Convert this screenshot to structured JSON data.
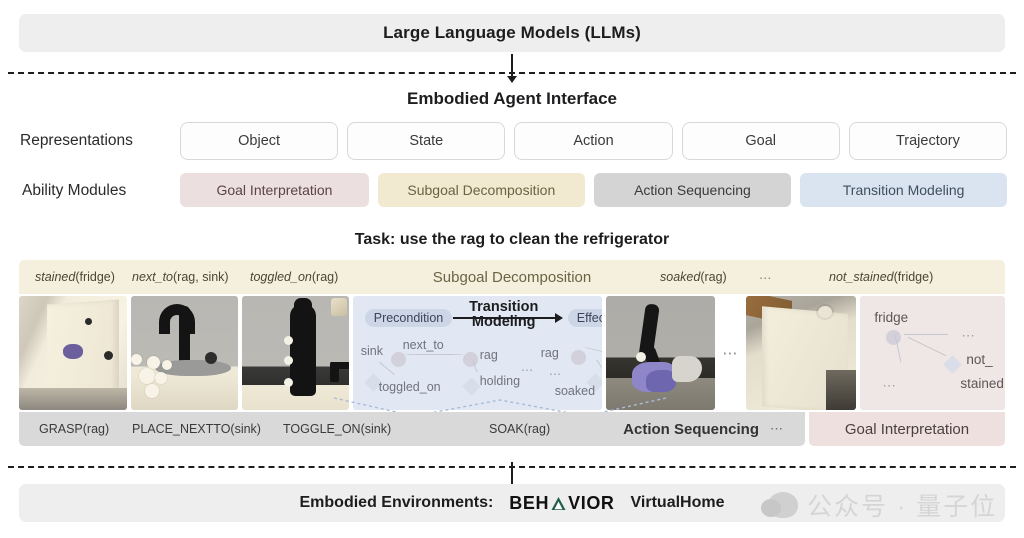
{
  "header": {
    "llm_banner": "Large Language Models (LLMs)",
    "interface_title": "Embodied Agent Interface"
  },
  "representations": {
    "label": "Representations",
    "items": [
      {
        "label": "Object"
      },
      {
        "label": "State"
      },
      {
        "label": "Action"
      },
      {
        "label": "Goal"
      },
      {
        "label": "Trajectory"
      }
    ]
  },
  "ability_modules": {
    "label": "Ability Modules",
    "items": [
      {
        "label": "Goal Interpretation",
        "color": "#ecdfe0"
      },
      {
        "label": "Subgoal Decomposition",
        "color": "#f1ead0"
      },
      {
        "label": "Action Sequencing",
        "color": "#d4d4d4"
      },
      {
        "label": "Transition Modeling",
        "color": "#d9e4f0"
      }
    ]
  },
  "task": {
    "title": "Task: use the rag to clean the refrigerator"
  },
  "subgoal_strip": {
    "module_label": "Subgoal Decomposition",
    "items": [
      {
        "pred": "stained",
        "args": "(fridge)"
      },
      {
        "pred": "next_to",
        "args": "(rag, sink)"
      },
      {
        "pred": "toggled_on",
        "args": "(sink)"
      },
      {
        "pred": "soaked",
        "args": "(rag)"
      },
      {
        "pred": "",
        "args": "⋯"
      },
      {
        "pred": "not_stained",
        "args": "(fridge)"
      }
    ]
  },
  "media_band": {
    "panels": [
      {
        "name": "fridge-stained-frame"
      },
      {
        "name": "sink-faucet-frame"
      },
      {
        "name": "sink-toggled-frame"
      },
      {
        "name": "rag-soaked-frame"
      },
      {
        "name": "fridge-clean-frame"
      }
    ],
    "ellipsis": "⋯"
  },
  "transition_modeling": {
    "title_line1": "Transition",
    "title_line2": "Modeling",
    "precondition_pill": "Precondition",
    "effect_pill": "Effect",
    "precondition_graph": {
      "nodes": [
        "sink",
        "rag"
      ],
      "edges": [
        "next_to",
        "toggled_on",
        "holding"
      ],
      "ellipsis": "⋯"
    },
    "effect_graph": {
      "nodes": [
        "rag"
      ],
      "edges": [
        "soaked"
      ],
      "ellipsis": "⋯"
    }
  },
  "goal_interpretation_panel": {
    "nodes": [
      "fridge"
    ],
    "edges": [
      "not_",
      "stained"
    ],
    "ellipsis_right": "⋯",
    "ellipsis_left": "⋯"
  },
  "action_strip": {
    "module_label": "Action Sequencing",
    "dots": "⋯",
    "items": [
      {
        "label": "GRASP(rag)"
      },
      {
        "label": "PLACE_NEXTTO(sink)"
      },
      {
        "label": "TOGGLE_ON(sink)"
      },
      {
        "label": "SOAK(rag)"
      }
    ],
    "goal_interpretation_label": "Goal Interpretation"
  },
  "footer": {
    "env_label": "Embodied Environments:",
    "behavior_part1": "BEH",
    "behavior_part2": "VIOR",
    "virtualhome": "VirtualHome"
  },
  "watermark": {
    "text": "公众号 · 量子位"
  }
}
